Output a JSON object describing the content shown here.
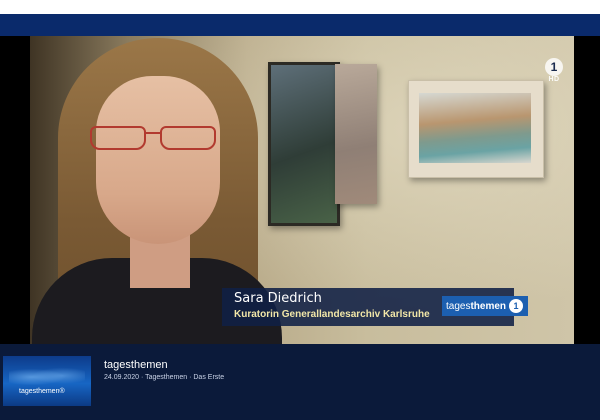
{
  "video": {
    "lower_third": {
      "name": "Sara Diedrich",
      "role": "Kuratorin Generallandesarchiv Karlsruhe"
    },
    "badge": {
      "prefix": "tages",
      "suffix": "themen",
      "mark": "1"
    },
    "channel_logo": {
      "mark": "1",
      "quality": "HD"
    }
  },
  "info": {
    "title": "tagesthemen",
    "meta": "24.09.2020 · Tagesthemen · Das Erste",
    "thumbnail_label": "tagesthemen®"
  },
  "colors": {
    "brand_blue": "#0a2a6b",
    "info_bg": "#0b1a3a",
    "badge_blue": "#1c5fb0"
  }
}
